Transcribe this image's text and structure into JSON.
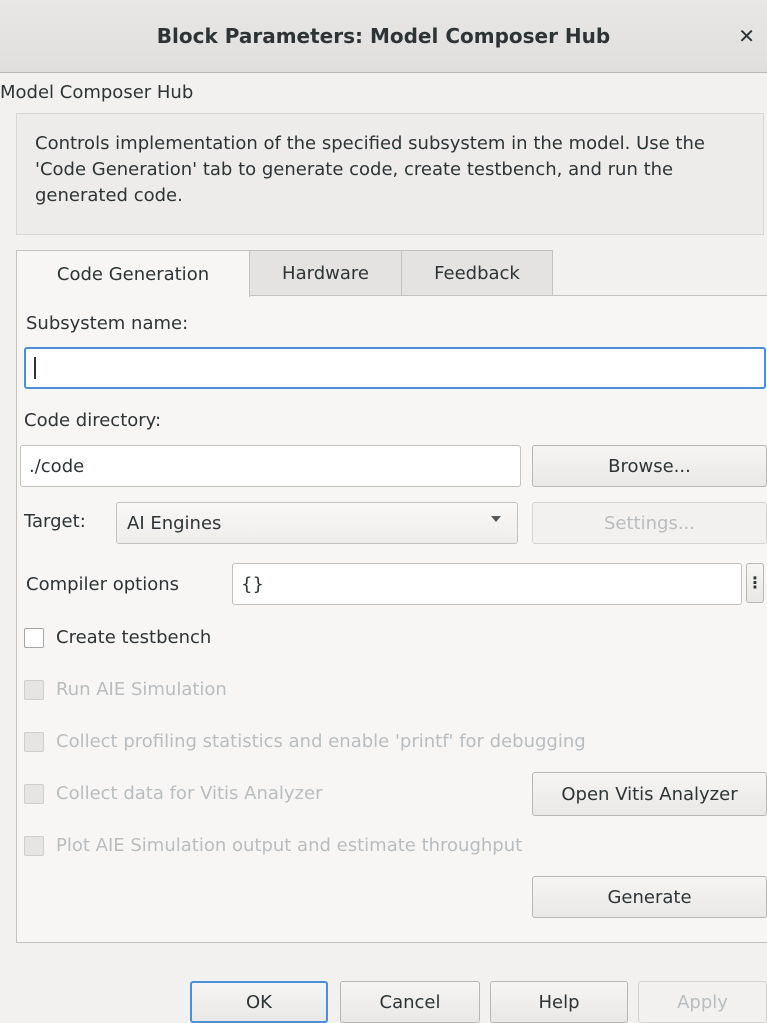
{
  "window": {
    "title": "Block Parameters: Model Composer Hub",
    "close_icon": "close-icon"
  },
  "block": {
    "name": "Model Composer Hub",
    "description": "Controls implementation of the specified subsystem in the model. Use the 'Code Generation' tab to generate code, create testbench, and run the generated code."
  },
  "tabs": [
    {
      "label": "Code Generation",
      "active": true
    },
    {
      "label": "Hardware",
      "active": false
    },
    {
      "label": "Feedback",
      "active": false
    }
  ],
  "form": {
    "subsystem_label": "Subsystem name:",
    "subsystem_value": "",
    "code_dir_label": "Code directory:",
    "code_dir_value": "./code",
    "browse_label": "Browse...",
    "target_label": "Target:",
    "target_value": "AI Engines",
    "settings_label": "Settings...",
    "compiler_label": "Compiler options",
    "compiler_value": "{}",
    "more_label": "⋮"
  },
  "checkboxes": [
    {
      "label": "Create testbench",
      "checked": false,
      "enabled": true
    },
    {
      "label": "Run AIE Simulation",
      "checked": false,
      "enabled": false
    },
    {
      "label": "Collect profiling statistics and enable 'printf' for debugging",
      "checked": false,
      "enabled": false
    },
    {
      "label": "Collect data for Vitis Analyzer",
      "checked": false,
      "enabled": false
    },
    {
      "label": "Plot AIE Simulation output and estimate throughput",
      "checked": false,
      "enabled": false
    }
  ],
  "actions": {
    "open_vitis_label": "Open Vitis Analyzer",
    "generate_label": "Generate"
  },
  "footer": {
    "ok_label": "OK",
    "cancel_label": "Cancel",
    "help_label": "Help",
    "apply_label": "Apply"
  },
  "colors": {
    "focus_accent": "#4a90d9",
    "disabled_text": "#b9bdbf"
  }
}
